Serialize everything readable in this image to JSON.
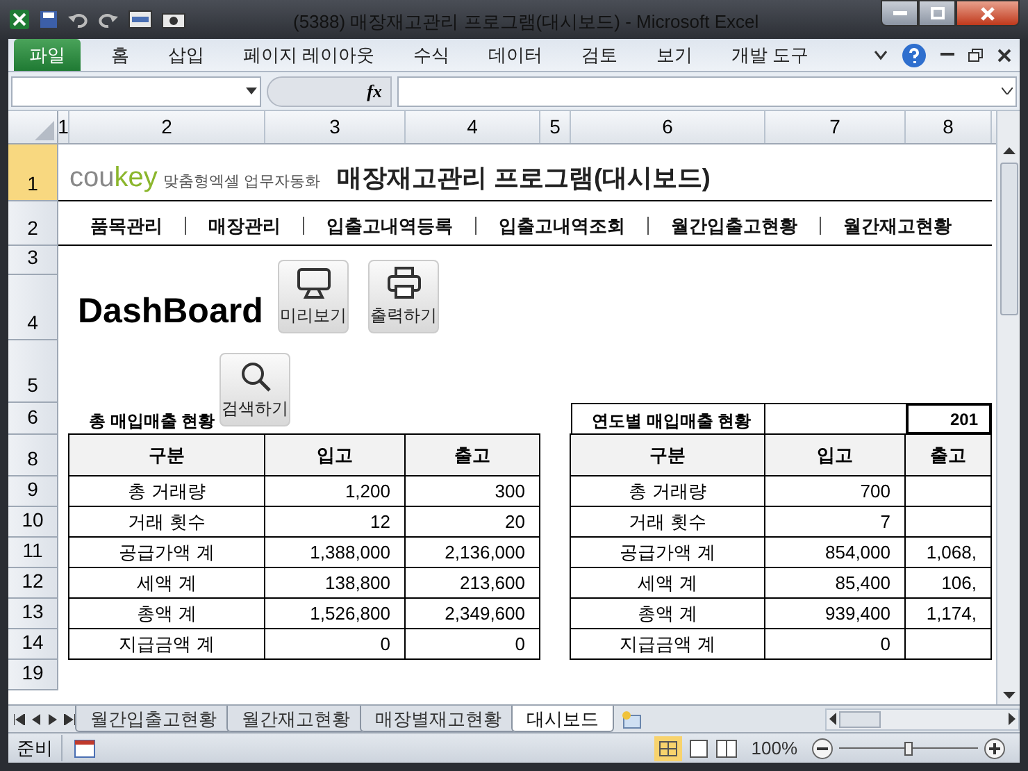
{
  "window": {
    "title": "(5388) 매장재고관리 프로그램(대시보드)  -  Microsoft Excel"
  },
  "ribbon": {
    "tabs": [
      {
        "label": "파일",
        "kind": "file",
        "selected": false
      },
      {
        "label": "홈",
        "kind": "tab",
        "selected": false
      },
      {
        "label": "삽입",
        "kind": "tab",
        "selected": false
      },
      {
        "label": "페이지 레이아웃",
        "kind": "tab",
        "selected": false
      },
      {
        "label": "수식",
        "kind": "tab",
        "selected": false
      },
      {
        "label": "데이터",
        "kind": "tab",
        "selected": false
      },
      {
        "label": "검토",
        "kind": "tab",
        "selected": false
      },
      {
        "label": "보기",
        "kind": "tab",
        "selected": false
      },
      {
        "label": "개발 도구",
        "kind": "tab",
        "selected": false
      }
    ]
  },
  "formula_bar": {
    "fx": "fx"
  },
  "column_headers": [
    "1",
    "2",
    "3",
    "4",
    "5",
    "6",
    "7",
    "8"
  ],
  "row_headers": [
    "1",
    "2",
    "3",
    "4",
    "5",
    "6",
    "8",
    "9",
    "10",
    "11",
    "12",
    "13",
    "14",
    "19"
  ],
  "sheet": {
    "logo": {
      "brand_a": "cou",
      "brand_b": "key",
      "tagline": "맞춤형엑셀 업무자동화"
    },
    "title": "매장재고관리 프로그램(대시보드)",
    "menu": [
      "품목관리",
      "매장관리",
      "입출고내역등록",
      "입출고내역조회",
      "월간입출고현황",
      "월간재고현황"
    ],
    "dashboard_title": "DashBoard",
    "buttons": [
      {
        "label": "미리보기",
        "kind": "monitor"
      },
      {
        "label": "출력하기",
        "kind": "printer"
      },
      {
        "label": "검색하기",
        "kind": "search"
      }
    ],
    "left_table": {
      "title": "총 매입매출 현황",
      "columns": [
        "구분",
        "입고",
        "출고"
      ],
      "rows": [
        [
          "총 거래량",
          "1,200",
          "300"
        ],
        [
          "거래 횟수",
          "12",
          "20"
        ],
        [
          "공급가액 계",
          "1,388,000",
          "2,136,000"
        ],
        [
          "세액 계",
          "138,800",
          "213,600"
        ],
        [
          "총액 계",
          "1,526,800",
          "2,349,600"
        ],
        [
          "지급금액 계",
          "0",
          "0"
        ]
      ]
    },
    "right_table": {
      "title": "연도별 매입매출 현황",
      "year": "201",
      "columns": [
        "구분",
        "입고",
        "출고"
      ],
      "rows": [
        [
          "총 거래량",
          "700",
          ""
        ],
        [
          "거래 횟수",
          "7",
          ""
        ],
        [
          "공급가액 계",
          "854,000",
          "1,068,"
        ],
        [
          "세액 계",
          "85,400",
          "106,"
        ],
        [
          "총액 계",
          "939,400",
          "1,174,"
        ],
        [
          "지급금액 계",
          "0",
          ""
        ]
      ]
    }
  },
  "sheet_tabs": [
    {
      "label": "월간입출고현황",
      "selected": false
    },
    {
      "label": "월간재고현황",
      "selected": false
    },
    {
      "label": "매장별재고현황",
      "selected": false
    },
    {
      "label": "대시보드",
      "selected": true
    }
  ],
  "status_bar": {
    "status": "준비",
    "zoom": "100%",
    "zoom_slider": {
      "level": 0.5
    }
  }
}
